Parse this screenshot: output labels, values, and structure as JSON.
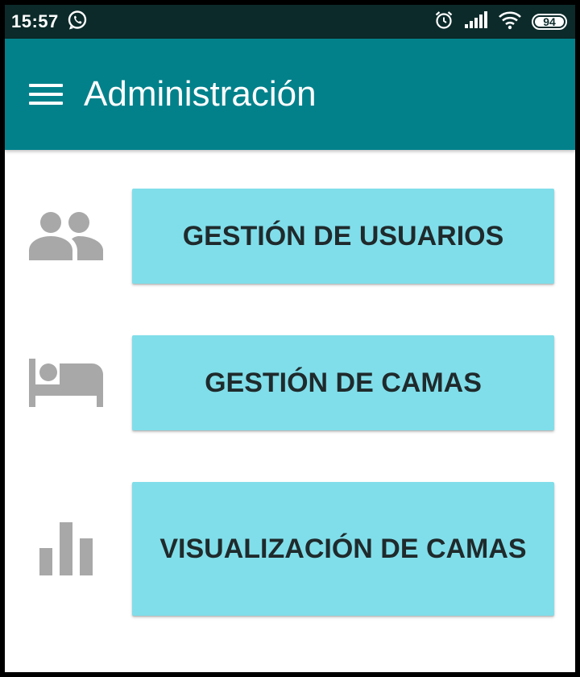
{
  "status_bar": {
    "time": "15:57",
    "battery": "94",
    "icons": [
      "whatsapp-icon",
      "alarm-icon",
      "signal-icon",
      "wifi-icon",
      "battery-icon"
    ]
  },
  "app_bar": {
    "title": "Administración",
    "menu_icon": "hamburger-menu-icon"
  },
  "menu": {
    "items": [
      {
        "label": "GESTIÓN DE USUARIOS",
        "icon": "users-icon"
      },
      {
        "label": "GESTIÓN DE CAMAS",
        "icon": "bed-icon"
      },
      {
        "label": "VISUALIZACIÓN DE CAMAS",
        "icon": "bar-chart-icon"
      }
    ]
  },
  "colors": {
    "status_bar": "#0c2a2a",
    "app_bar": "#02818b",
    "button": "#80deea",
    "button_text": "#1f2a2c",
    "icon": "#a8a8a8"
  }
}
